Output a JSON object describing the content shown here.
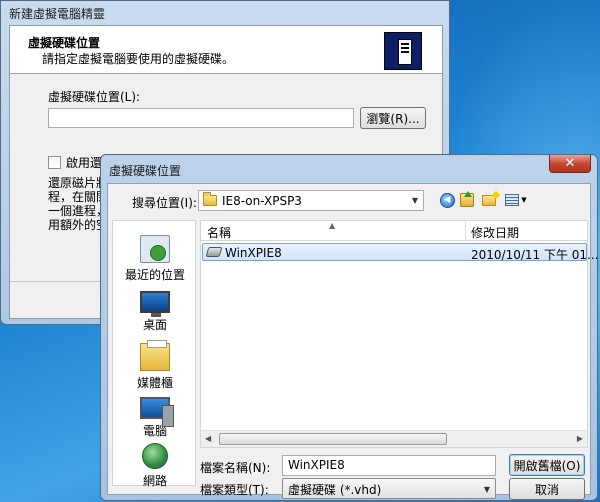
{
  "wizard": {
    "title": "新建虛擬電腦精靈",
    "header_title": "虛擬硬碟位置",
    "header_subtitle": "請指定虛擬電腦要使用的虛擬硬碟。",
    "location_label": "虛擬硬碟位置(L):",
    "location_value": "",
    "browse_label": "瀏覽(R)...",
    "checkbox_label": "啟用還原磁片(E)",
    "desc_lines": [
      "還原磁片將",
      "程，在關閉",
      "一個進程，",
      "用額外的空"
    ]
  },
  "dialog": {
    "title": "虛擬硬碟位置",
    "close_glyph": "✕",
    "lookin_label": "搜尋位置(I):",
    "lookin_value": "IE8-on-XPSP3",
    "places": [
      {
        "label": "最近的位置",
        "icon": "recent-places-icon"
      },
      {
        "label": "桌面",
        "icon": "desktop-icon"
      },
      {
        "label": "媒體櫃",
        "icon": "libraries-icon"
      },
      {
        "label": "電腦",
        "icon": "computer-icon"
      },
      {
        "label": "網路",
        "icon": "network-icon"
      }
    ],
    "columns": {
      "name": "名稱",
      "modified": "修改日期"
    },
    "files": [
      {
        "name": "WinXPIE8",
        "modified": "2010/10/11 下午 01...",
        "icon": "virtual-disk-icon",
        "selected": true
      }
    ],
    "filename_label": "檔案名稱(N):",
    "filename_value": "WinXPIE8",
    "filetype_label": "檔案類型(T):",
    "filetype_value": "虛擬硬碟 (*.vhd)",
    "open_label": "開啟舊檔(O)",
    "cancel_label": "取消"
  }
}
